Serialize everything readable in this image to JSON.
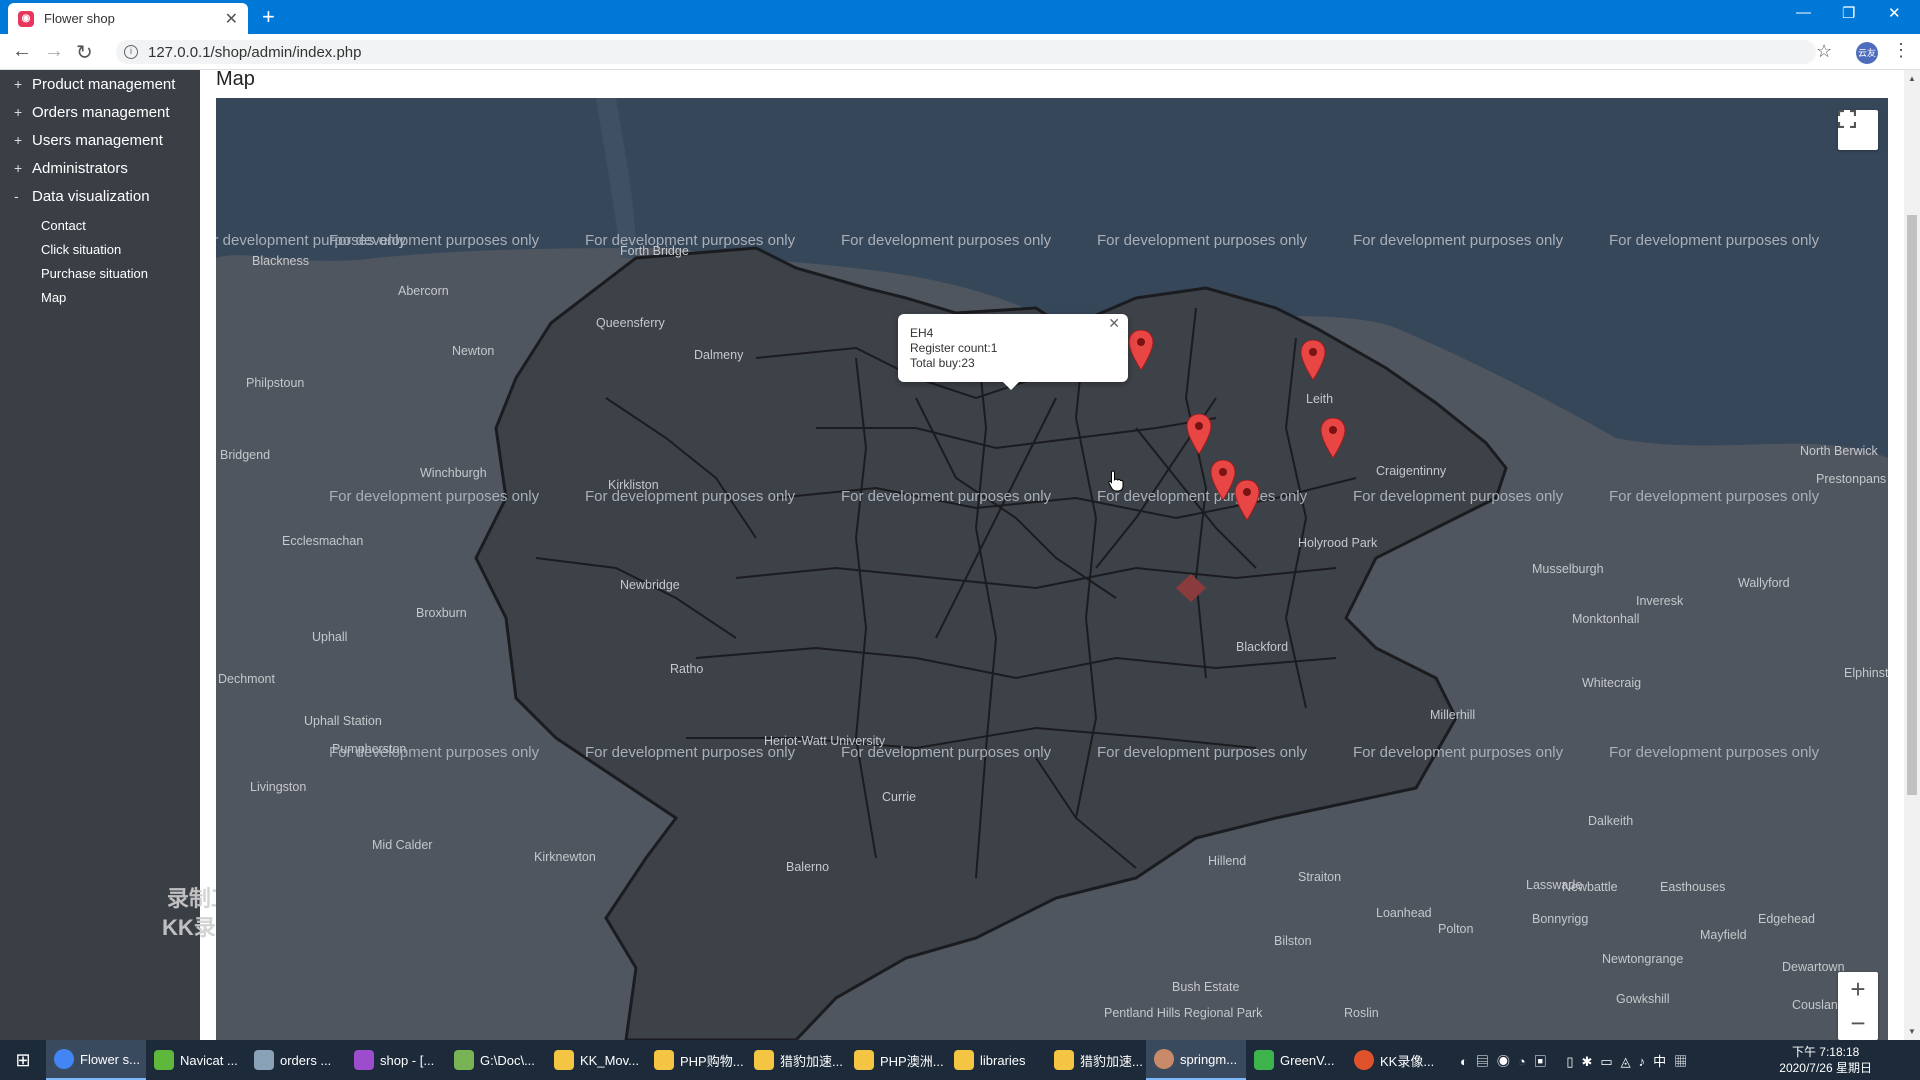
{
  "browser": {
    "tab_title": "Flower shop",
    "url": "127.0.0.1/shop/admin/index.php",
    "profile": "云友"
  },
  "sidebar": {
    "items": [
      {
        "label": "Product management",
        "toggle": "+"
      },
      {
        "label": "Orders management",
        "toggle": "+"
      },
      {
        "label": "Users management",
        "toggle": "+"
      },
      {
        "label": "Administrators",
        "toggle": "+"
      },
      {
        "label": "Data visualization",
        "toggle": "-"
      }
    ],
    "subitems": [
      "Contact",
      "Click situation",
      "Purchase situation",
      "Map"
    ],
    "watermark_line1": "录制工具",
    "watermark_line2": "KK录像机"
  },
  "main": {
    "title": "Map",
    "dev_notice": "For development purposes only",
    "infowindow": {
      "postcode": "EH4",
      "register": "Register count:1",
      "total": "Total buy:23"
    },
    "places": [
      "Blackness",
      "Abercorn",
      "Newton",
      "Queensferry",
      "Dalmeny",
      "Philpstoun",
      "Bridgend",
      "Winchburgh",
      "Kirkliston",
      "Ecclesmachan",
      "Newbridge",
      "Broxburn",
      "Uphall",
      "Dechmont",
      "Ratho",
      "Uphall Station",
      "Pumpherston",
      "Livingston",
      "Mid Calder",
      "Kirknewton",
      "Balerno",
      "Currie",
      "Hillend",
      "Straiton",
      "Loanhead",
      "Bilston",
      "Bush Estate",
      "Pentland Hills Regional Park",
      "Roslin",
      "Lasswade",
      "Bonnyrigg",
      "Polton",
      "Newtongrange",
      "Gowkshill",
      "Mayfield",
      "Easthouses",
      "Newbattle",
      "Dalkeith",
      "Millerhill",
      "Whitecraig",
      "Monktonhall",
      "Inveresk",
      "Musselburgh",
      "Wallyford",
      "Prestonpans",
      "Edgehead",
      "Dewartown",
      "Cousland",
      "Blackford",
      "Holyrood Park",
      "Leith",
      "Craigentinny",
      "North Berwick",
      "Elphinstone",
      "Forth Bridge",
      "Heriot-Watt University"
    ]
  },
  "taskbar": {
    "apps": [
      "Flower s...",
      "Navicat ...",
      "orders ...",
      "shop - [...",
      "G:\\Doc\\...",
      "KK_Mov...",
      "PHP购物...",
      "猎豹加速...",
      "PHP澳洲...",
      "libraries",
      "猎豹加速...",
      "springm...",
      "GreenV...",
      "KK录像..."
    ],
    "time": "下午 7:18:18",
    "date": "2020/7/26 星期日"
  },
  "colors": {
    "sidebar_bg": "#3a3f46",
    "map_land": "#50565f",
    "map_sea": "#36475a",
    "pin": "#e84545",
    "titlebar": "#0078d7"
  }
}
